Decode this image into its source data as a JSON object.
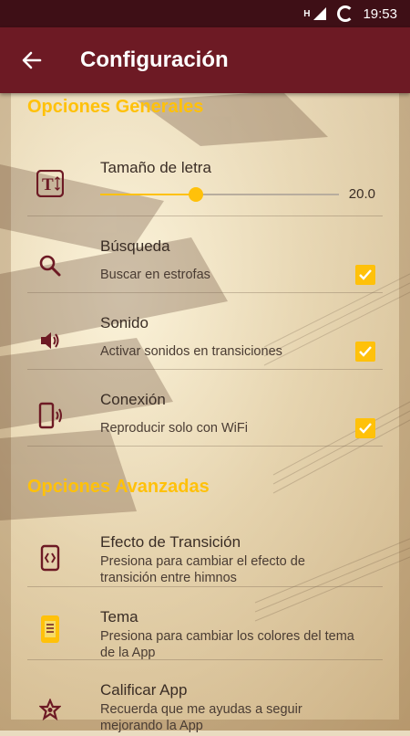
{
  "status_bar": {
    "signal_label": "H",
    "time": "19:53"
  },
  "app_bar": {
    "title": "Configuración",
    "back_icon": "arrow-back-icon"
  },
  "general": {
    "title": "Opciones Generales",
    "font_size": {
      "title": "Tamaño de letra",
      "value": "20.0",
      "fraction": 0.4,
      "icon": "text-size-icon"
    },
    "search": {
      "title": "Búsqueda",
      "summary": "Buscar en estrofas",
      "checked": true,
      "icon": "search-icon"
    },
    "sound": {
      "title": "Sonido",
      "summary": "Activar sonidos en transiciones",
      "checked": true,
      "icon": "volume-icon"
    },
    "connection": {
      "title": "Conexión",
      "summary": "Reproducir solo con WiFi",
      "checked": true,
      "icon": "phone-wifi-icon"
    }
  },
  "advanced": {
    "title": "Opciones Avanzadas",
    "transition": {
      "title": "Efecto de Transición",
      "summary": "Presiona para cambiar el efecto de transición entre himnos",
      "icon": "transition-icon"
    },
    "theme": {
      "title": "Tema",
      "summary": "Presiona para cambiar los colores del tema de la App",
      "icon": "theme-icon"
    },
    "rate": {
      "title": "Calificar App",
      "summary": "Recuerda que me ayudas a seguir mejorando la App",
      "icon": "star-icon"
    }
  },
  "colors": {
    "accent": "#ffc10a",
    "primary": "#6d1a24",
    "status": "#3e0f16"
  }
}
